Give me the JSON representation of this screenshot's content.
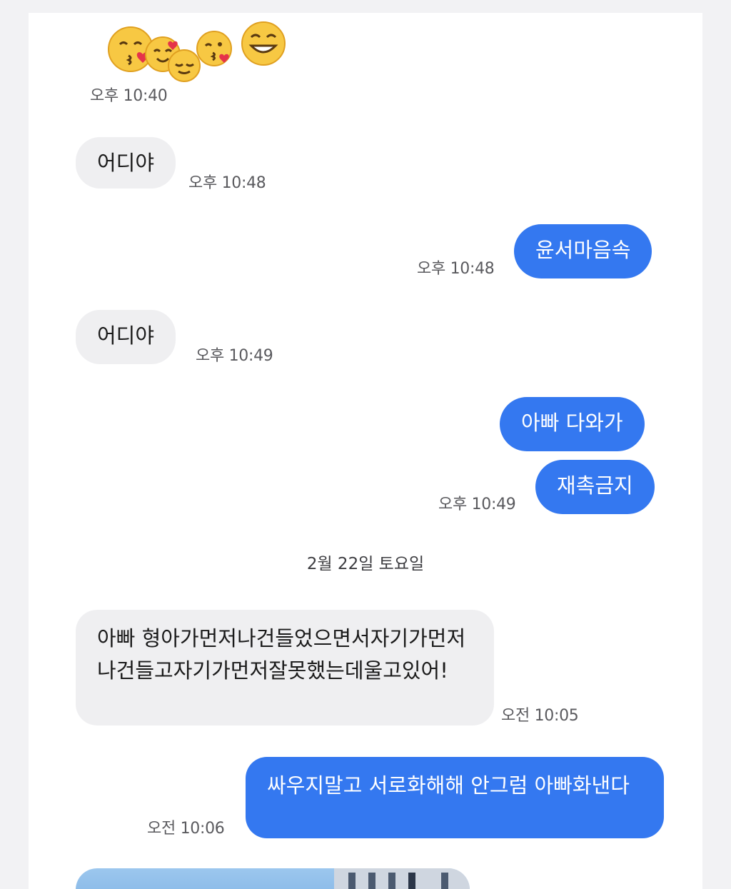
{
  "messages": [
    {
      "time": "오후 10:40"
    },
    {
      "text": "어디야",
      "time": "오후 10:48"
    },
    {
      "text": "윤서마음속",
      "time": "오후 10:48"
    },
    {
      "text": "어디야",
      "time": "오후 10:49"
    },
    {
      "text": "아빠 다와가"
    },
    {
      "text": "재촉금지",
      "time": "오후 10:49"
    },
    {
      "text": "아빠 형아가먼저나건들었으면서자기가먼저나건들고자기가먼저잘못했는데울고있어!",
      "time": "오전 10:05"
    },
    {
      "text": "싸우지말고 서로화해해 안그럼 아빠화낸다",
      "time": "오전 10:06"
    }
  ],
  "date_separator": "2월 22일 토요일",
  "colors": {
    "outgoing": "#3478f0",
    "incoming": "#efeff1",
    "background": "#ffffff"
  },
  "icons": [
    "kissing-face-emoji",
    "smiling-face-hearts-emoji",
    "relieved-face-emoji",
    "grinning-face-emoji"
  ]
}
